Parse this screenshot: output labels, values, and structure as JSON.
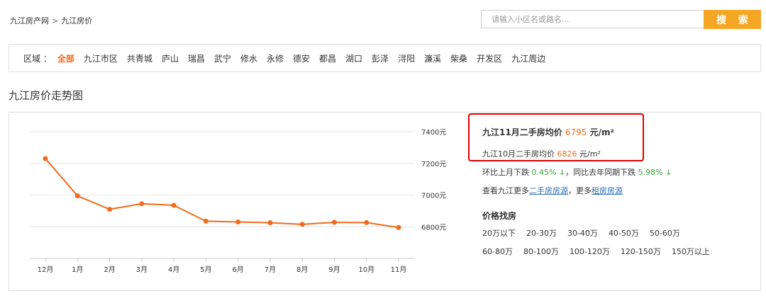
{
  "breadcrumb": {
    "home": "九江房产网",
    "separator": ">",
    "current": "九江房价"
  },
  "search": {
    "placeholder": "请输入小区名或路名...",
    "button": "搜 索"
  },
  "districts": {
    "label": "区域 ：",
    "items": [
      "全部",
      "九江市区",
      "共青城",
      "庐山",
      "瑞昌",
      "武宁",
      "修水",
      "永修",
      "德安",
      "都昌",
      "湖口",
      "彭泽",
      "浔阳",
      "濂溪",
      "柴桑",
      "开发区",
      "九江周边"
    ],
    "active": "全部"
  },
  "section_title": "九江房价走势图",
  "info": {
    "main_prefix": "九江11月二手房均价",
    "main_value": "6795",
    "main_unit": "元/m²",
    "sub_prefix": "九江10月二手房均价",
    "sub_value": "6826",
    "sub_unit": "元/m²",
    "mom_prefix": "环比上月下跌",
    "mom_value": "0.45% ↓",
    "yoy_prefix": "，同比去年同期下跌",
    "yoy_value": "5.98% ↓",
    "more_prefix": "查看九江更多",
    "more_link1": "二手房房源",
    "more_mid": "，更多",
    "more_link2": "租房房源",
    "price_title": "价格找房",
    "price_row1": [
      "20万以下",
      "20-30万",
      "30-40万",
      "40-50万",
      "50-60万"
    ],
    "price_row2": [
      "60-80万",
      "80-100万",
      "100-120万",
      "120-150万",
      "150万以上"
    ]
  },
  "colors": {
    "accent": "#f26a1b",
    "button": "#f5a623",
    "down": "#3aa33a",
    "highlight": "#e00000",
    "link": "#2a6fb3"
  },
  "chart_data": {
    "type": "line",
    "categories": [
      "12月",
      "1月",
      "2月",
      "3月",
      "4月",
      "5月",
      "6月",
      "7月",
      "8月",
      "9月",
      "10月",
      "11月"
    ],
    "values": [
      7230,
      6995,
      6910,
      6945,
      6935,
      6835,
      6830,
      6825,
      6815,
      6828,
      6826,
      6795
    ],
    "yticks": [
      6800,
      7000,
      7200,
      7400
    ],
    "ytick_suffix": "元",
    "ylim": [
      6600,
      7400
    ],
    "grid": true,
    "axis_side": "right"
  }
}
